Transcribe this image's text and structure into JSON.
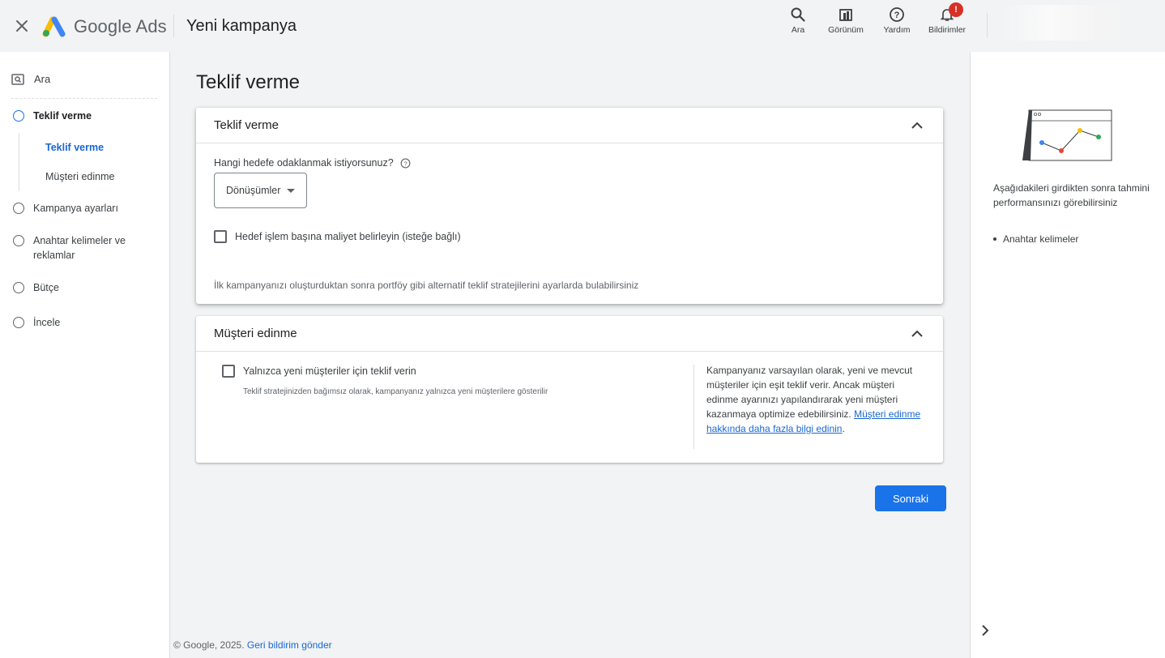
{
  "header": {
    "brand": "Google Ads",
    "title": "Yeni kampanya",
    "tools": {
      "search": "Ara",
      "view": "Görünüm",
      "help": "Yardım",
      "notifications": "Bildirimler",
      "notification_badge": "!"
    }
  },
  "sidebar": {
    "search_label": "Ara",
    "steps": [
      {
        "label": "Teklif verme",
        "active": true
      },
      {
        "label": "Kampanya ayarları"
      },
      {
        "label": "Anahtar kelimeler ve reklamlar"
      },
      {
        "label": "Bütçe"
      },
      {
        "label": "İncele"
      }
    ],
    "substeps": [
      {
        "label": "Teklif verme",
        "active": true
      },
      {
        "label": "Müşteri edinme"
      }
    ]
  },
  "main": {
    "page_title": "Teklif verme",
    "bidding_card": {
      "title": "Teklif verme",
      "question": "Hangi hedefe odaklanmak istiyorsunuz?",
      "select_value": "Dönüşümler",
      "checkbox_label": "Hedef işlem başına maliyet belirleyin (isteğe bağlı)",
      "note": "İlk kampanyanızı oluşturduktan sonra portföy gibi alternatif teklif stratejilerini ayarlarda bulabilirsiniz"
    },
    "acquisition_card": {
      "title": "Müşteri edinme",
      "checkbox_label": "Yalnızca yeni müşteriler için teklif verin",
      "helper": "Teklif stratejinizden bağımsız olarak, kampanyanız yalnızca yeni müşterilere gösterilir",
      "info_text": "Kampanyanız varsayılan olarak, yeni ve mevcut müşteriler için eşit teklif verir. Ancak müşteri edinme ayarınızı yapılandırarak yeni müşteri kazanmaya optimize edebilirsiniz.",
      "info_link": "Müşteri edinme hakkında daha fazla bilgi edinin",
      "info_period": "."
    },
    "next_button": "Sonraki"
  },
  "footer": {
    "copyright": "© Google, 2025.",
    "feedback": "Geri bildirim gönder"
  },
  "right_panel": {
    "text": "Aşağıdakileri girdikten sonra tahmini performansınızı görebilirsiniz",
    "items": [
      "Anahtar kelimeler"
    ]
  },
  "colors": {
    "primary": "#1a73e8",
    "link": "#1967d2",
    "badge": "#d93025"
  }
}
